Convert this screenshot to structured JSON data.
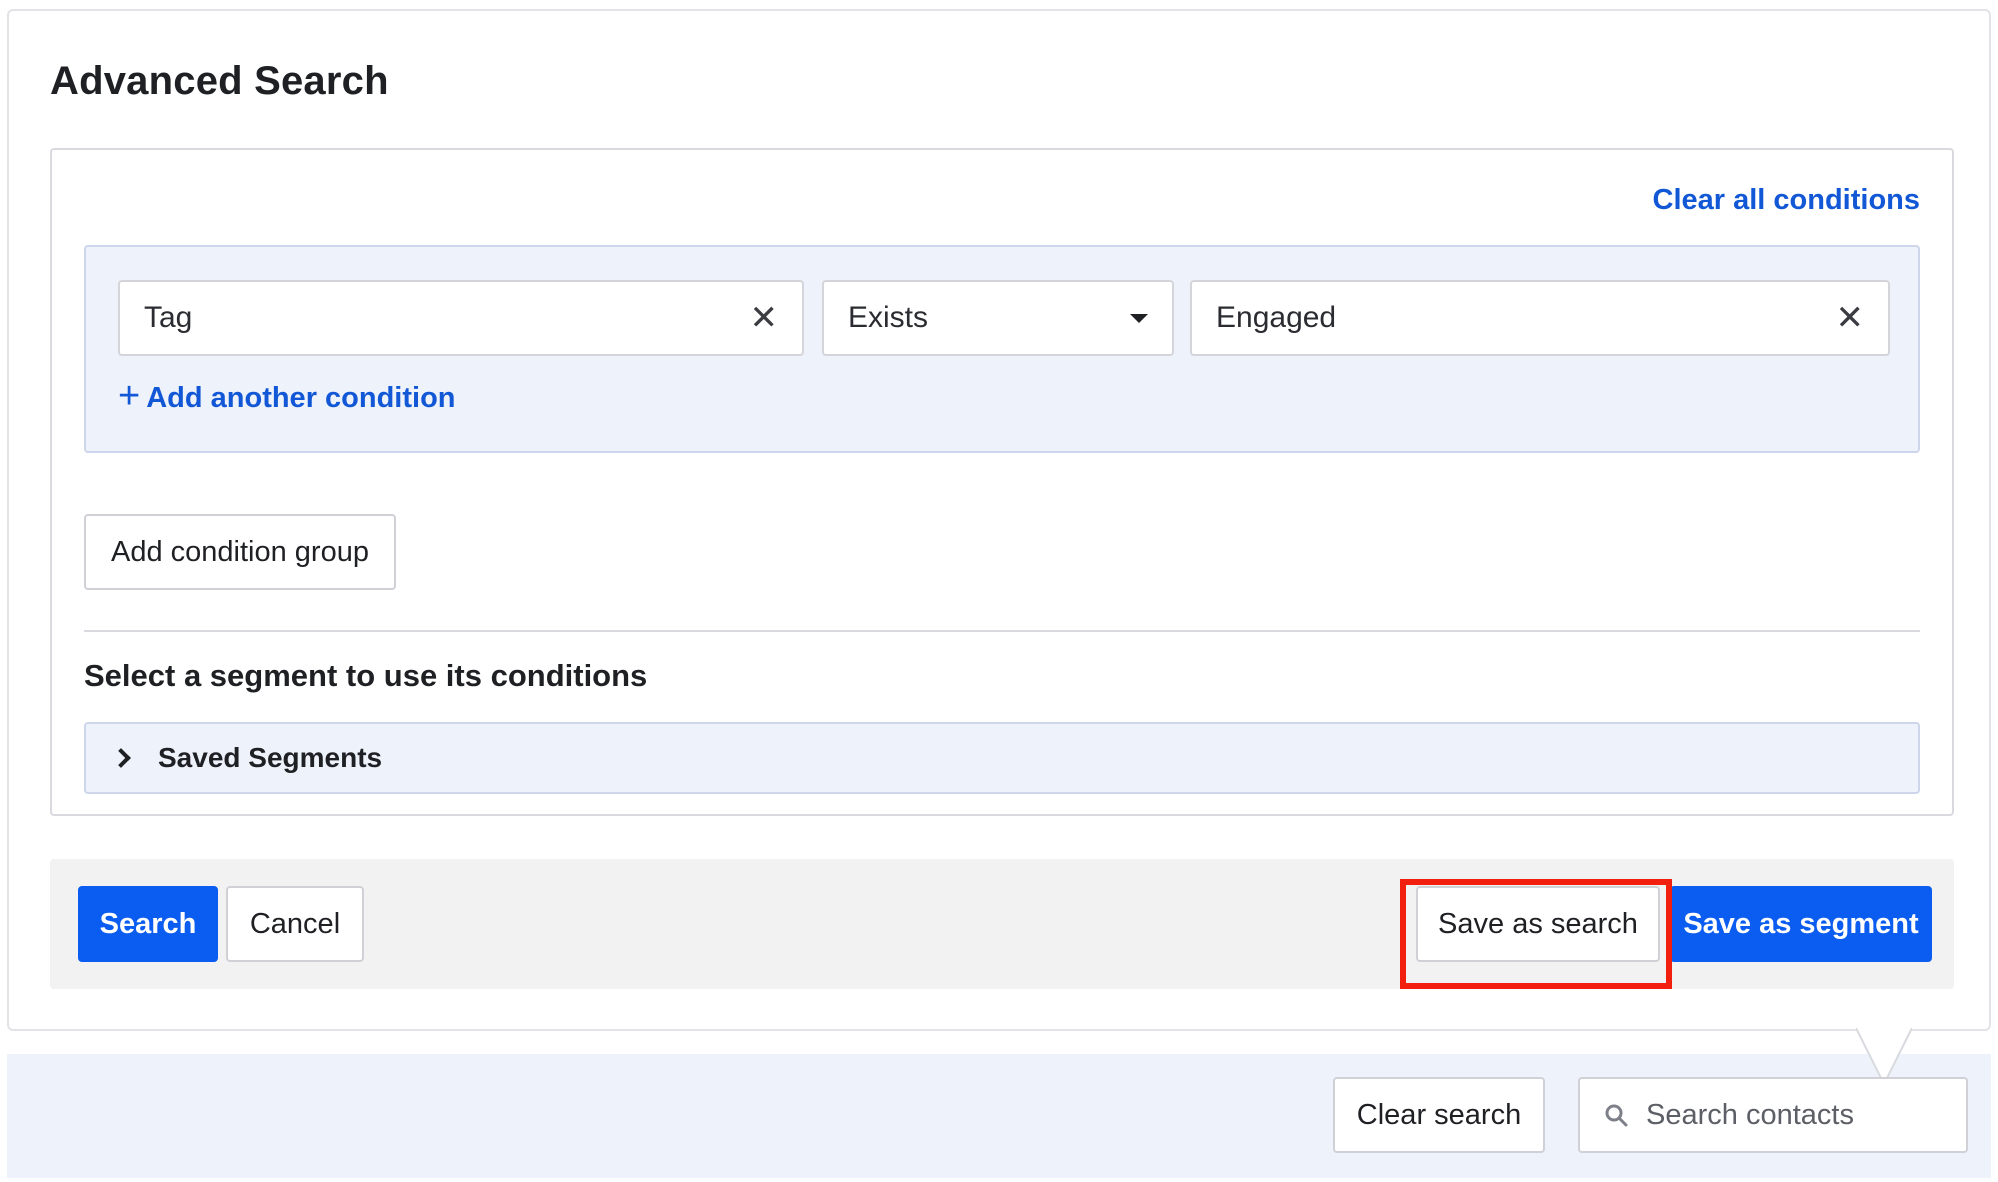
{
  "panel": {
    "title": "Advanced Search",
    "clear_all_label": "Clear all conditions"
  },
  "condition_group": {
    "conditions": [
      {
        "field": "Tag",
        "operator": "Exists",
        "value": "Engaged"
      }
    ],
    "add_condition_label": "Add another condition"
  },
  "add_group_label": "Add condition group",
  "segments": {
    "heading": "Select a segment to use its conditions",
    "accordion_label": "Saved Segments",
    "expanded": false
  },
  "footer": {
    "search_label": "Search",
    "cancel_label": "Cancel",
    "save_search_label": "Save as search",
    "save_segment_label": "Save as segment"
  },
  "bottom_bar": {
    "clear_search_label": "Clear search",
    "search_placeholder": "Search contacts"
  },
  "colors": {
    "primary": "#0b5cf0",
    "link": "#1258d6",
    "highlight": "#f21f0f",
    "group_bg": "#eef2fb"
  },
  "icons": {
    "remove_field": "close-icon",
    "remove_value": "close-icon",
    "operator_dropdown": "caret-down-icon",
    "add": "plus-icon",
    "accordion": "chevron-right-icon",
    "search": "magnifier-icon"
  }
}
